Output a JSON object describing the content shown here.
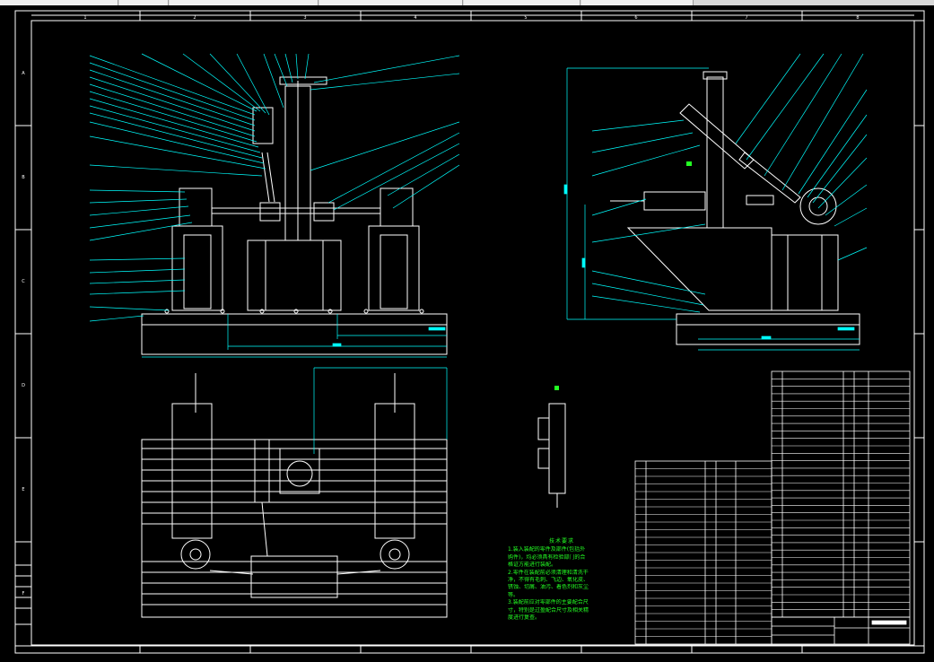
{
  "tabs": [
    {
      "label": ""
    },
    {
      "label": ""
    },
    {
      "label": ""
    },
    {
      "label": ""
    },
    {
      "label": ""
    },
    {
      "label": ""
    }
  ],
  "drawing": {
    "col_labels": [
      "1",
      "2",
      "3",
      "4",
      "5",
      "6",
      "7",
      "8"
    ],
    "row_labels": [
      "A",
      "B",
      "C",
      "D",
      "E",
      "F"
    ],
    "tech_title": "技术要求",
    "tech_notes": [
      "1.装入装配的零件及部件(包括外",
      "购件)，均必须具有检验部门的合",
      "格证方能进行装配。",
      "2.零件在装配前必须清理和清洗干",
      "净，不得有毛刺、飞边、氧化皮、",
      "锈蚀、切屑、油污、着色剂和灰尘",
      "等。",
      "3.装配前应对零部件的主要配合尺",
      "寸，特别是过盈配合尺寸及相关精",
      "度进行复查。"
    ]
  },
  "colors": {
    "background": "#000000",
    "frame": "#ffffff",
    "leader": "#00ffff",
    "dimension": "#00ffff",
    "text": "#23ff23",
    "accent_blue": "#3a7bff"
  }
}
